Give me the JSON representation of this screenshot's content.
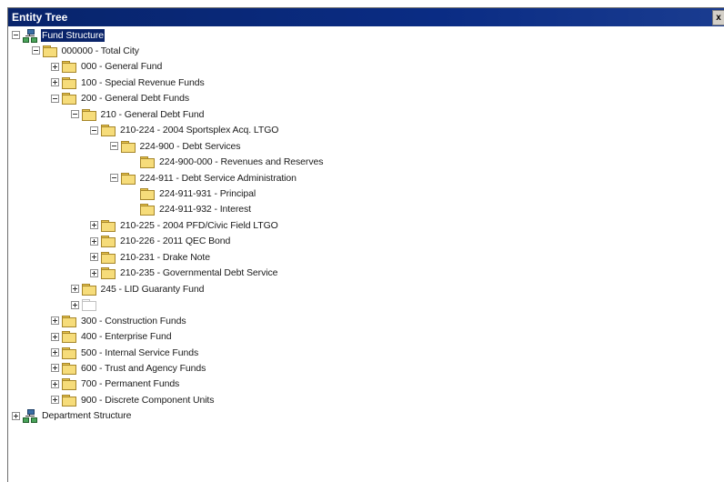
{
  "window": {
    "title": "Entity Tree",
    "close_label": "x"
  },
  "tree": [
    {
      "label": "Fund Structure",
      "icon": "org-chart-icon",
      "expander": "minus",
      "level": 0,
      "selected": true
    },
    {
      "label": "000000 - Total City",
      "icon": "folder-icon",
      "expander": "minus",
      "level": 1
    },
    {
      "label": "000 - General Fund",
      "icon": "folder-icon",
      "expander": "plus",
      "level": 2
    },
    {
      "label": "100 - Special Revenue Funds",
      "icon": "folder-icon",
      "expander": "plus",
      "level": 2
    },
    {
      "label": "200 - General Debt Funds",
      "icon": "folder-icon",
      "expander": "minus",
      "level": 2
    },
    {
      "label": "210 - General Debt Fund",
      "icon": "folder-icon",
      "expander": "minus",
      "level": 3
    },
    {
      "label": "210-224 - 2004 Sportsplex Acq. LTGO",
      "icon": "folder-icon",
      "expander": "minus",
      "level": 4
    },
    {
      "label": "224-900 - Debt Services",
      "icon": "folder-icon",
      "expander": "minus",
      "level": 5
    },
    {
      "label": "224-900-000 - Revenues and Reserves",
      "icon": "folder-icon",
      "expander": "none",
      "level": 6
    },
    {
      "label": "224-911 - Debt Service Administration",
      "icon": "folder-icon",
      "expander": "minus",
      "level": 5
    },
    {
      "label": "224-911-931 - Principal",
      "icon": "folder-icon",
      "expander": "none",
      "level": 6
    },
    {
      "label": "224-911-932 - Interest",
      "icon": "folder-icon",
      "expander": "none",
      "level": 6
    },
    {
      "label": "210-225 - 2004 PFD/Civic Field LTGO",
      "icon": "folder-icon",
      "expander": "plus",
      "level": 4
    },
    {
      "label": "210-226 - 2011 QEC Bond",
      "icon": "folder-icon",
      "expander": "plus",
      "level": 4
    },
    {
      "label": "210-231 - Drake Note",
      "icon": "folder-icon",
      "expander": "plus",
      "level": 4
    },
    {
      "label": "210-235 - Governmental Debt Service",
      "icon": "folder-icon",
      "expander": "plus",
      "level": 4
    },
    {
      "label": "245 - LID Guaranty Fund",
      "icon": "folder-icon",
      "expander": "plus",
      "level": 3
    },
    {
      "label": "",
      "icon": "empty-folder-icon",
      "expander": "plus",
      "level": 3
    },
    {
      "label": "300 - Construction Funds",
      "icon": "folder-icon",
      "expander": "plus",
      "level": 2
    },
    {
      "label": "400 - Enterprise Fund",
      "icon": "folder-icon",
      "expander": "plus",
      "level": 2
    },
    {
      "label": "500 - Internal Service Funds",
      "icon": "folder-icon",
      "expander": "plus",
      "level": 2
    },
    {
      "label": "600 - Trust and Agency Funds",
      "icon": "folder-icon",
      "expander": "plus",
      "level": 2
    },
    {
      "label": "700 - Permanent Funds",
      "icon": "folder-icon",
      "expander": "plus",
      "level": 2
    },
    {
      "label": "900 - Discrete Component Units",
      "icon": "folder-icon",
      "expander": "plus",
      "level": 2
    },
    {
      "label": "Department Structure",
      "icon": "org-chart-icon",
      "expander": "plus",
      "level": 0
    }
  ]
}
